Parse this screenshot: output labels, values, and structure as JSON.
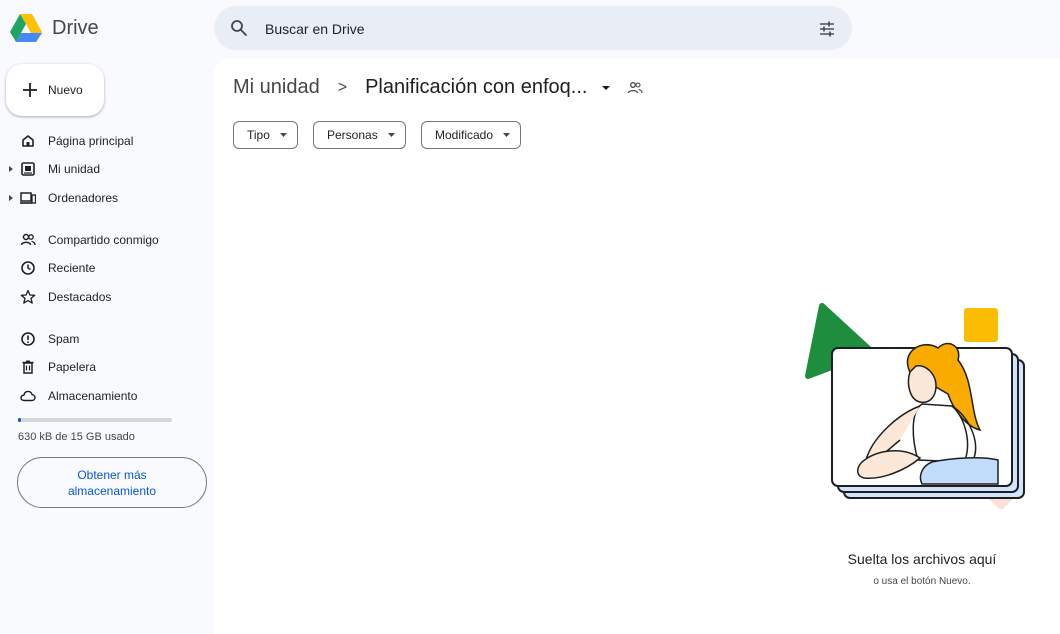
{
  "app": {
    "name": "Drive"
  },
  "search": {
    "placeholder": "Buscar en Drive"
  },
  "sidebar": {
    "new_label": "Nuevo",
    "items": [
      {
        "label": "Página principal",
        "icon": "home-icon"
      },
      {
        "label": "Mi unidad",
        "icon": "my-drive-icon",
        "expandable": true
      },
      {
        "label": "Ordenadores",
        "icon": "computers-icon",
        "expandable": true
      },
      {
        "label": "Compartido conmigo",
        "icon": "shared-icon"
      },
      {
        "label": "Reciente",
        "icon": "clock-icon"
      },
      {
        "label": "Destacados",
        "icon": "star-icon"
      },
      {
        "label": "Spam",
        "icon": "spam-icon"
      },
      {
        "label": "Papelera",
        "icon": "trash-icon"
      },
      {
        "label": "Almacenamiento",
        "icon": "cloud-icon"
      }
    ],
    "storage": {
      "used_text": "630 kB de 15 GB usado",
      "used_fraction": 0.01,
      "button_line1": "Obtener más",
      "button_line2": "almacenamiento"
    }
  },
  "breadcrumb": {
    "root": "Mi unidad",
    "separator": ">",
    "current": "Planificación con enfoq..."
  },
  "filters": [
    {
      "label": "Tipo"
    },
    {
      "label": "Personas"
    },
    {
      "label": "Modificado"
    }
  ],
  "empty_state": {
    "title": "Suelta los archivos aquí",
    "subtitle": "o usa el botón Nuevo."
  },
  "colors": {
    "accent": "#0b57d0",
    "background": "#f8fafd",
    "search_bg": "#e9eef6",
    "logo_green": "#1fa463",
    "logo_yellow": "#ffd04b",
    "logo_blue": "#4688f4"
  }
}
